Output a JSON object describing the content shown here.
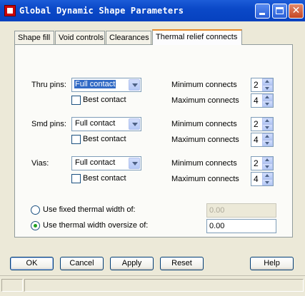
{
  "window": {
    "title": "Global Dynamic Shape Parameters"
  },
  "tabs": [
    {
      "label": "Shape fill"
    },
    {
      "label": "Void controls"
    },
    {
      "label": "Clearances"
    },
    {
      "label": "Thermal relief connects"
    }
  ],
  "rows": [
    {
      "label": "Thru pins:",
      "select_value": "Full contact",
      "best_contact_label": "Best contact",
      "best_contact_checked": false,
      "min_label": "Minimum connects",
      "min_value": "2",
      "max_label": "Maximum connects",
      "max_value": "4"
    },
    {
      "label": "Smd pins:",
      "select_value": "Full contact",
      "best_contact_label": "Best contact",
      "best_contact_checked": false,
      "min_label": "Minimum connects",
      "min_value": "2",
      "max_label": "Maximum connects",
      "max_value": "4"
    },
    {
      "label": "Vias:",
      "select_value": "Full contact",
      "best_contact_label": "Best contact",
      "best_contact_checked": false,
      "min_label": "Minimum connects",
      "min_value": "2",
      "max_label": "Maximum connects",
      "max_value": "4"
    }
  ],
  "thermal_width": {
    "fixed_label": "Use fixed thermal width of:",
    "fixed_value": "0.00",
    "fixed_selected": false,
    "oversize_label": "Use thermal width oversize of:",
    "oversize_value": "0.00",
    "oversize_selected": true
  },
  "buttons": {
    "ok": "OK",
    "cancel": "Cancel",
    "apply": "Apply",
    "reset": "Reset",
    "help": "Help"
  },
  "colors": {
    "titlebar": "#0b49c8",
    "active_tab_accent": "#e68b2c",
    "selection": "#316ac5",
    "radio_dot": "#21a121"
  }
}
